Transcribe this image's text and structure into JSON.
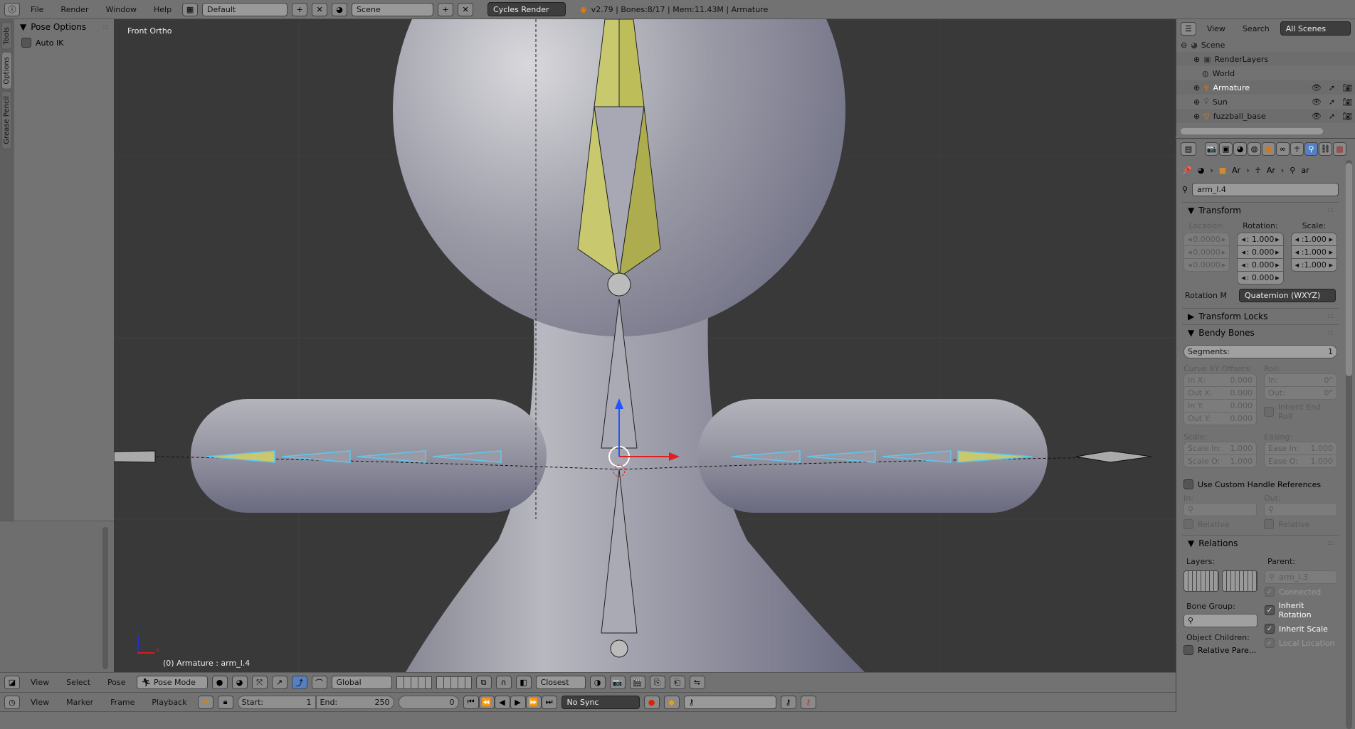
{
  "topbar": {
    "menus": [
      "File",
      "Render",
      "Window",
      "Help"
    ],
    "layout": "Default",
    "scene": "Scene",
    "engine": "Cycles Render",
    "status": "v2.79 | Bones:8/17  | Mem:11.43M | Armature"
  },
  "toolshelf": {
    "tabs": [
      "Tools",
      "Options",
      "Grease Pencil"
    ],
    "active_tab": "Options",
    "panel_title": "Pose Options",
    "auto_ik_label": "Auto IK",
    "auto_ik": false
  },
  "viewport": {
    "view_label": "Front Ortho",
    "object_info": "(0) Armature : arm_l.4",
    "axis_z": "z",
    "axis_x": "x"
  },
  "outliner": {
    "menus": [
      "View",
      "Search"
    ],
    "filter": "All Scenes",
    "items": [
      {
        "label": "Scene",
        "icon": "scene-icon",
        "depth": 0
      },
      {
        "label": "RenderLayers",
        "icon": "renderlayers-icon",
        "depth": 1
      },
      {
        "label": "World",
        "icon": "world-icon",
        "depth": 1
      },
      {
        "label": "Armature",
        "icon": "armature-icon",
        "depth": 1,
        "highlight": true
      },
      {
        "label": "Sun",
        "icon": "lamp-icon",
        "depth": 1
      },
      {
        "label": "fuzzball_base",
        "icon": "mesh-icon",
        "depth": 1
      }
    ]
  },
  "properties": {
    "breadcrumb": [
      "Ar",
      "Ar",
      "ar"
    ],
    "bone_name": "arm_l.4",
    "transform": {
      "title": "Transform",
      "location_label": "Location:",
      "rotation_label": "Rotation:",
      "scale_label": "Scale:",
      "location": [
        "0.0000",
        "0.0000",
        "0.0000"
      ],
      "rotation": [
        ": 1.000",
        ": 0.000",
        ": 0.000",
        ": 0.000"
      ],
      "scale": [
        ":1.000",
        ":1.000",
        ":1.000"
      ],
      "rotation_mode_label": "Rotation M",
      "rotation_mode": "Quaternion (WXYZ)"
    },
    "transform_locks": {
      "title": "Transform Locks"
    },
    "bendy": {
      "title": "Bendy Bones",
      "segments_label": "Segments:",
      "segments": "1",
      "curve_label": "Curve XY Offsets:",
      "roll_label": "Roll:",
      "curve": [
        {
          "k": "In X:",
          "v": "0.000"
        },
        {
          "k": "Out X:",
          "v": "0.000"
        },
        {
          "k": "In Y:",
          "v": "0.000"
        },
        {
          "k": "Out Y:",
          "v": "0.000"
        }
      ],
      "roll": [
        {
          "k": "In:",
          "v": "0°"
        },
        {
          "k": "Out:",
          "v": "0°"
        }
      ],
      "inherit_end_roll": "Inherit End Roll",
      "scale_label": "Scale:",
      "easing_label": "Easing:",
      "scale": [
        {
          "k": "Scale In:",
          "v": "1.000"
        },
        {
          "k": "Scale O:",
          "v": "1.000"
        }
      ],
      "easing": [
        {
          "k": "Ease In:",
          "v": "1.000"
        },
        {
          "k": "Ease O:",
          "v": "1.000"
        }
      ],
      "custom_handles": "Use Custom Handle References",
      "in_label": "In:",
      "out_label": "Out:",
      "relative": "Relative"
    },
    "relations": {
      "title": "Relations",
      "layers_label": "Layers:",
      "parent_label": "Parent:",
      "parent": "arm_l.3",
      "connected": "Connected",
      "inherit_rotation": "Inherit Rotation",
      "inherit_scale": "Inherit Scale",
      "local_location": "Local Location",
      "bone_group_label": "Bone Group:",
      "object_children_label": "Object Children:",
      "relative_parent": "Relative Pare..."
    }
  },
  "header3d": {
    "menus": [
      "View",
      "Select",
      "Pose"
    ],
    "mode": "Pose Mode",
    "orientation": "Global",
    "snap": "Closest"
  },
  "timeline": {
    "menus": [
      "View",
      "Marker",
      "Frame",
      "Playback"
    ],
    "start_label": "Start:",
    "start": "1",
    "end_label": "End:",
    "end": "250",
    "current": "0",
    "sync": "No Sync"
  },
  "colors": {
    "bg": "#727272",
    "viewport": "#393939",
    "selected_bone": "#5ec8ee",
    "active_bone": "#c8c86e"
  }
}
